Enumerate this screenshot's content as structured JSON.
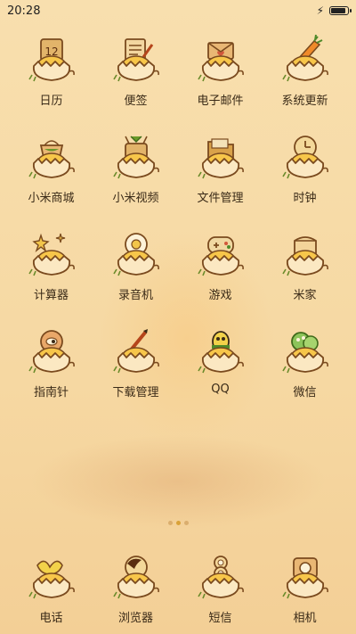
{
  "status_bar": {
    "time": "20:28",
    "battery_level": 1.0
  },
  "apps": [
    {
      "label": "日历",
      "icon": "calendar-icon"
    },
    {
      "label": "便签",
      "icon": "notes-icon"
    },
    {
      "label": "电子邮件",
      "icon": "email-icon"
    },
    {
      "label": "系统更新",
      "icon": "update-icon"
    },
    {
      "label": "小米商城",
      "icon": "shop-icon"
    },
    {
      "label": "小米视频",
      "icon": "video-icon"
    },
    {
      "label": "文件管理",
      "icon": "folder-icon"
    },
    {
      "label": "时钟",
      "icon": "clock-icon"
    },
    {
      "label": "计算器",
      "icon": "calculator-icon"
    },
    {
      "label": "录音机",
      "icon": "recorder-icon"
    },
    {
      "label": "游戏",
      "icon": "gamepad-icon"
    },
    {
      "label": "米家",
      "icon": "home-icon"
    },
    {
      "label": "指南针",
      "icon": "compass-icon"
    },
    {
      "label": "下载管理",
      "icon": "download-icon"
    },
    {
      "label": "QQ",
      "icon": "qq-icon"
    },
    {
      "label": "微信",
      "icon": "wechat-icon"
    }
  ],
  "dock": [
    {
      "label": "电话",
      "icon": "phone-icon"
    },
    {
      "label": "浏览器",
      "icon": "browser-icon"
    },
    {
      "label": "短信",
      "icon": "messages-icon"
    },
    {
      "label": "相机",
      "icon": "camera-icon"
    }
  ],
  "page_indicator": {
    "count": 3,
    "current": 2
  }
}
